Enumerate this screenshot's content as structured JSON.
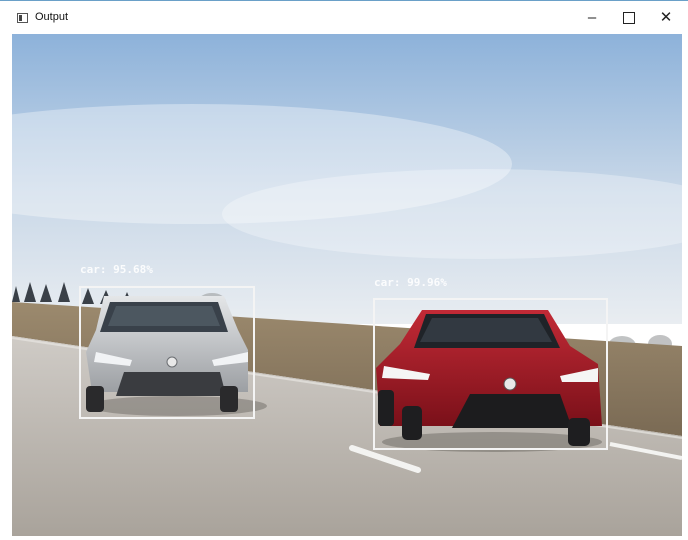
{
  "window": {
    "title": "Output",
    "icon": "app-window-icon",
    "controls": {
      "minimize_icon": "minimize-icon",
      "maximize_icon": "maximize-icon",
      "close_glyph": "✕",
      "minimize_glyph": "–"
    }
  },
  "detections": [
    {
      "label": "car: 95.68%",
      "color": "#ffffff"
    },
    {
      "label": "car: 99.96%",
      "color": "#ffffff"
    }
  ],
  "colors": {
    "sky_top": "#8fb4dc",
    "sky_bottom": "#e6ecf2",
    "grass": "#8a7a62",
    "road": "#bcb8b2",
    "car_silver": "#b9bcc0",
    "car_red": "#9a1a26"
  }
}
